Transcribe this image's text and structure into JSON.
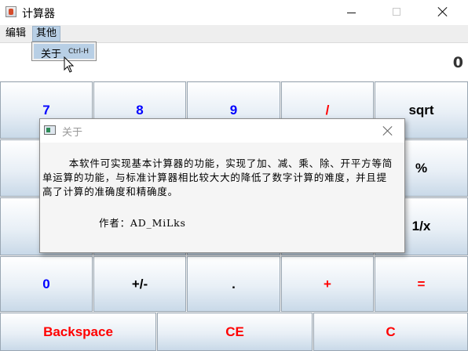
{
  "window": {
    "title": "计算器"
  },
  "menubar": {
    "items": [
      "编辑",
      "其他"
    ]
  },
  "dropdown": {
    "label": "关于",
    "shortcut": "Ctrl-H"
  },
  "display": {
    "value": "0"
  },
  "keys": {
    "row1": [
      "7",
      "8",
      "9",
      "/",
      "sqrt"
    ],
    "r2_last": "%",
    "r3_last": "1/x",
    "row4": [
      "0",
      "+/-",
      ".",
      "+",
      "="
    ],
    "row5": [
      "Backspace",
      "CE",
      "C"
    ]
  },
  "dialog": {
    "title": "关于",
    "body": "本软件可实现基本计算器的功能，实现了加、减、乘、除、开平方等简单运算的功能，与标准计算器相比较大大的降低了数字计算的难度，并且提高了计算的准确度和精确度。",
    "author": "作者：AD_MiLks"
  },
  "colors": {
    "digit": "#0000ff",
    "operator": "#ff0000",
    "function": "#000000",
    "highlight": "#b8cfe5"
  }
}
